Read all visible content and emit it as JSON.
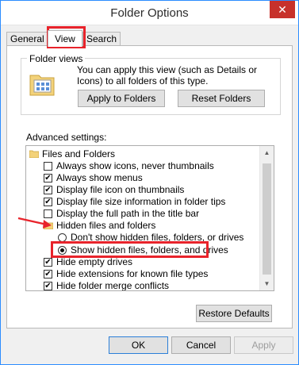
{
  "window": {
    "title": "Folder Options",
    "close_glyph": "✕"
  },
  "tabs": [
    {
      "label": "General"
    },
    {
      "label": "View",
      "active": true
    },
    {
      "label": "Search"
    }
  ],
  "folder_views": {
    "group_title": "Folder views",
    "description": "You can apply this view (such as Details or Icons) to all folders of this type.",
    "apply_button": "Apply to Folders",
    "reset_button": "Reset Folders",
    "icon": "folder-views-icon"
  },
  "advanced": {
    "label": "Advanced settings:",
    "root": "Files and Folders",
    "items": [
      {
        "label": "Always show icons, never thumbnails",
        "checked": false
      },
      {
        "label": "Always show menus",
        "checked": true
      },
      {
        "label": "Display file icon on thumbnails",
        "checked": true
      },
      {
        "label": "Display file size information in folder tips",
        "checked": true
      },
      {
        "label": "Display the full path in the title bar",
        "checked": false
      }
    ],
    "hidden_group": "Hidden files and folders",
    "radios": [
      {
        "label": "Don't show hidden files, folders, or drives",
        "selected": false
      },
      {
        "label": "Show hidden files, folders, and drives",
        "selected": true
      }
    ],
    "items_after": [
      {
        "label": "Hide empty drives",
        "checked": true
      },
      {
        "label": "Hide extensions for known file types",
        "checked": true
      },
      {
        "label": "Hide folder merge conflicts",
        "checked": true
      }
    ]
  },
  "restore_button": "Restore Defaults",
  "footer": {
    "ok": "OK",
    "cancel": "Cancel",
    "apply": "Apply"
  },
  "colors": {
    "accent": "#2b8cff",
    "annotation": "#e8232b",
    "close": "#c7312b"
  }
}
